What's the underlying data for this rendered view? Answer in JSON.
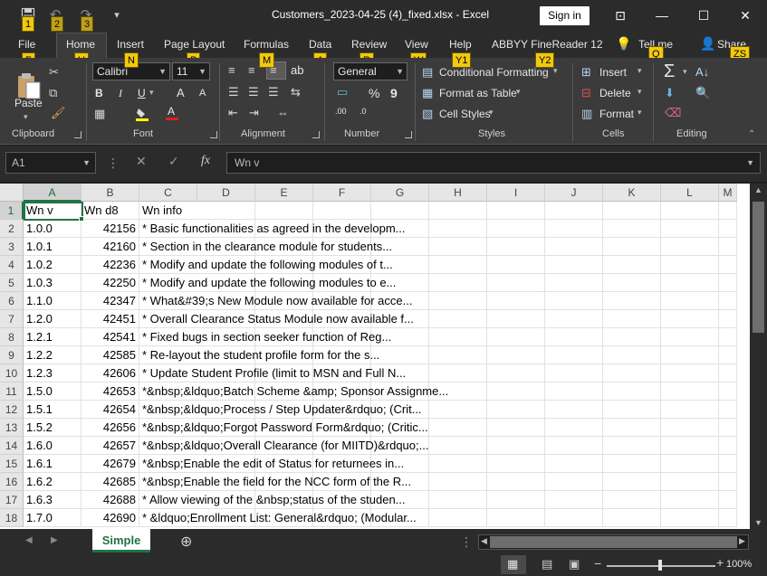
{
  "window": {
    "title": "Customers_2023-04-25 (4)_fixed.xlsx  -  Excel",
    "sign_in": "Sign in",
    "minimize_glyph": "—",
    "maximize_glyph": "☐",
    "close_glyph": "✕",
    "ribbon_display_glyph": "⊡"
  },
  "quick_access": {
    "keytips": [
      "1",
      "2",
      "3"
    ],
    "save_glyph": "💾",
    "undo_glyph": "↶",
    "redo_glyph": "↷",
    "customize_glyph": "▾"
  },
  "tabs": [
    {
      "label": "File",
      "keytip": "F"
    },
    {
      "label": "Home",
      "keytip": "H"
    },
    {
      "label": "Insert",
      "keytip": "N"
    },
    {
      "label": "Page Layout",
      "keytip": "P"
    },
    {
      "label": "Formulas",
      "keytip": "M"
    },
    {
      "label": "Data",
      "keytip": "A"
    },
    {
      "label": "Review",
      "keytip": "R"
    },
    {
      "label": "View",
      "keytip": "W"
    },
    {
      "label": "Help",
      "keytip": "Y1"
    },
    {
      "label": "ABBYY FineReader 12",
      "keytip": "Y2"
    },
    {
      "label": "Tell me",
      "keytip": "Q"
    },
    {
      "label": "Share",
      "keytip": "ZS"
    }
  ],
  "ribbon": {
    "clipboard": {
      "label": "Clipboard",
      "paste": "Paste"
    },
    "font": {
      "label": "Font",
      "name": "Calibri",
      "size": "11",
      "bold": "B",
      "italic": "I",
      "underline": "U",
      "grow": "A",
      "shrink": "A",
      "color_a": "A"
    },
    "alignment": {
      "label": "Alignment"
    },
    "number": {
      "label": "Number",
      "format": "General",
      "percent": "%",
      "comma": "9",
      "inc_dec": ".00",
      "dec_dec": ".0"
    },
    "styles": {
      "label": "Styles",
      "conditional": "Conditional Formatting",
      "format_table": "Format as Table",
      "cell_styles": "Cell Styles"
    },
    "cells": {
      "label": "Cells",
      "insert": "Insert",
      "delete": "Delete",
      "format": "Format"
    },
    "editing": {
      "label": "Editing",
      "sum": "Σ"
    }
  },
  "formula_bar": {
    "name_box": "A1",
    "cancel": "✕",
    "enter": "✓",
    "fx": "fx",
    "content": "Wn v"
  },
  "columns": [
    "A",
    "B",
    "C",
    "D",
    "E",
    "F",
    "G",
    "H",
    "I",
    "J",
    "K",
    "L",
    "M"
  ],
  "rows": [
    {
      "n": "1",
      "a": "Wn v",
      "b": "Wn d8",
      "c": "Wn info"
    },
    {
      "n": "2",
      "a": "1.0.0",
      "b": "42156",
      "c": "* Basic functionalities as agreed in the developm..."
    },
    {
      "n": "3",
      "a": "1.0.1",
      "b": "42160",
      "c": "* Section in the clearance module for students..."
    },
    {
      "n": "4",
      "a": "1.0.2",
      "b": "42236",
      "c": "* Modify and update the following modules of t..."
    },
    {
      "n": "5",
      "a": "1.0.3",
      "b": "42250",
      "c": "* Modify and update the following modules to e..."
    },
    {
      "n": "6",
      "a": "1.1.0",
      "b": "42347",
      "c": "* What&#39;s New Module now available for acce..."
    },
    {
      "n": "7",
      "a": "1.2.0",
      "b": "42451",
      "c": "* Overall Clearance Status Module now available f..."
    },
    {
      "n": "8",
      "a": "1.2.1",
      "b": "42541",
      "c": "* Fixed bugs in section seeker function of Reg..."
    },
    {
      "n": "9",
      "a": "1.2.2",
      "b": "42585",
      "c": "* Re-layout the student profile form for the s..."
    },
    {
      "n": "10",
      "a": "1.2.3",
      "b": "42606",
      "c": "* Update Student Profile (limit to MSN and Full N..."
    },
    {
      "n": "11",
      "a": "1.5.0",
      "b": "42653",
      "c": "*&nbsp;&ldquo;Batch Scheme &amp; Sponsor Assignme..."
    },
    {
      "n": "12",
      "a": "1.5.1",
      "b": "42654",
      "c": "*&nbsp;&ldquo;Process / Step Updater&rdquo; (Crit..."
    },
    {
      "n": "13",
      "a": "1.5.2",
      "b": "42656",
      "c": "*&nbsp;&ldquo;Forgot Password Form&rdquo; (Critic..."
    },
    {
      "n": "14",
      "a": "1.6.0",
      "b": "42657",
      "c": "*&nbsp;&ldquo;Overall Clearance (for MIITD)&rdquo;..."
    },
    {
      "n": "15",
      "a": "1.6.1",
      "b": "42679",
      "c": "*&nbsp;Enable the edit of Status for returnees in..."
    },
    {
      "n": "16",
      "a": "1.6.2",
      "b": "42685",
      "c": "*&nbsp;Enable the field for the NCC form of the R..."
    },
    {
      "n": "17",
      "a": "1.6.3",
      "b": "42688",
      "c": "* Allow viewing of the &nbsp;status of the studen..."
    },
    {
      "n": "18",
      "a": "1.7.0",
      "b": "42690",
      "c": "* &ldquo;Enrollment List: General&rdquo; (Modular..."
    }
  ],
  "sheet_tabs": [
    {
      "label": "Simple",
      "active": true
    }
  ],
  "add_sheet_glyph": "⊕",
  "status": {
    "zoom": "100%",
    "zoom_out": "−",
    "zoom_in": "+"
  },
  "colors": {
    "accent": "#217346",
    "keytip": "#f2c811",
    "chrome": "#2b2b2b",
    "ribbon": "#3b3b3b"
  }
}
